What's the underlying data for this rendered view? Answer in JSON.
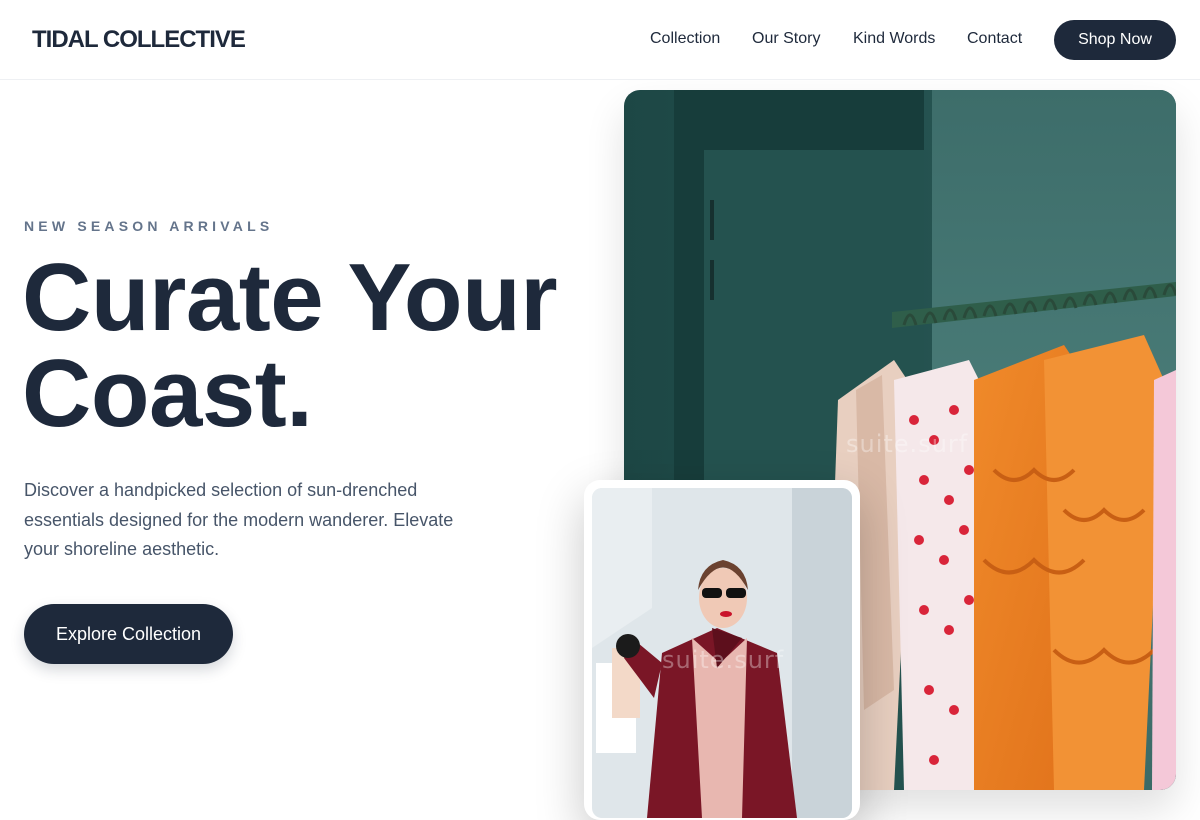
{
  "header": {
    "logo": "TIDAL COLLECTIVE",
    "nav": [
      {
        "label": "Collection"
      },
      {
        "label": "Our Story"
      },
      {
        "label": "Kind Words"
      },
      {
        "label": "Contact"
      }
    ],
    "cta": "Shop Now"
  },
  "hero": {
    "eyebrow": "NEW SEASON ARRIVALS",
    "headline_line1": "Curate Your",
    "headline_line2": "Coast.",
    "description": "Discover a handpicked selection of sun-drenched essentials designed for the modern wanderer. Elevate your shoreline aesthetic.",
    "button": "Explore Collection"
  },
  "images": {
    "main_alt": "Clothing rack with colorful garments against a teal wall",
    "secondary_alt": "Woman in red coat and sunglasses holding shopping bags"
  },
  "watermark": "suite.surf",
  "colors": {
    "primary": "#1e293b",
    "muted": "#64748b",
    "body": "#475569"
  }
}
